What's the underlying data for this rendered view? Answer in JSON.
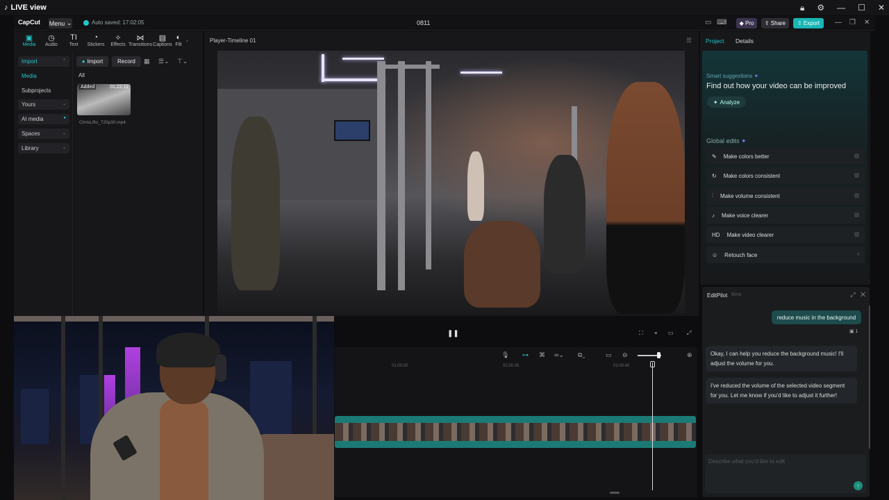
{
  "os_window": {
    "title": "LIVE view",
    "controls": [
      "🔒",
      "⚙",
      "—",
      "☐",
      "✕"
    ]
  },
  "topbar": {
    "logo": "CapCut",
    "menu_label": "Menu",
    "autosave": "Auto saved: 17:02:05",
    "project_name": "0811",
    "pro_label": "Pro",
    "share_label": "Share",
    "export_label": "Export",
    "colors": {
      "accent": "#22c7c7"
    }
  },
  "toolbar": {
    "items": [
      {
        "label": "Media",
        "icon": "▣"
      },
      {
        "label": "Audio",
        "icon": "◷"
      },
      {
        "label": "Text",
        "icon": "TI"
      },
      {
        "label": "Stickers",
        "icon": "◔"
      },
      {
        "label": "Effects",
        "icon": "✧"
      },
      {
        "label": "Transitions",
        "icon": "⋈"
      },
      {
        "label": "Captions",
        "icon": "▤"
      },
      {
        "label": "Filt",
        "icon": "◐"
      }
    ]
  },
  "sidebar": {
    "items": [
      {
        "label": "Import",
        "chev": "⌃"
      },
      {
        "label": "Media",
        "chev": ""
      },
      {
        "label": "Subprojects",
        "chev": ""
      },
      {
        "label": "Yours",
        "chev": "⌄"
      },
      {
        "label": "AI media",
        "chev": "●"
      },
      {
        "label": "Spaces",
        "chev": "⌄"
      },
      {
        "label": "Library",
        "chev": "⌄"
      }
    ]
  },
  "media": {
    "import_label": "Import",
    "record_label": "Record",
    "filter_label": "All",
    "clip": {
      "badge": "Added",
      "duration": "01:22:11",
      "name": "ChrisLifts_720p30.mp4"
    }
  },
  "player": {
    "title": "Player-Timeline 01"
  },
  "right_panel": {
    "tabs": [
      "Project",
      "Details"
    ],
    "smart_title": "Smart suggestions",
    "smart_heading": "Find out how your video can be improved",
    "analyze_label": "Analyze",
    "global_title": "Global edits",
    "global_items": [
      {
        "label": "Make colors better",
        "icon": "✎"
      },
      {
        "label": "Make colors consistent",
        "icon": "↻"
      },
      {
        "label": "Make volume consistent",
        "icon": "⫶"
      },
      {
        "label": "Make voice clearer",
        "icon": "♪"
      },
      {
        "label": "Make video clearer",
        "icon": "HD"
      },
      {
        "label": "Retouch face",
        "icon": "☺"
      }
    ]
  },
  "editpilot": {
    "title": "EditPilot",
    "beta": "Beta",
    "user_message": "reduce music in the background",
    "reply_1": "Okay, I can help you reduce the background music! I'll adjust the volume for you.",
    "reply_2": "I've reduced the volume of the selected video segment for you. Let me know if you'd like to adjust it further!",
    "input_placeholder": "Describe what you'd like to edit"
  },
  "timeline": {
    "ticks": [
      "01:00:30",
      "01:00:35",
      "01:00:40"
    ]
  }
}
